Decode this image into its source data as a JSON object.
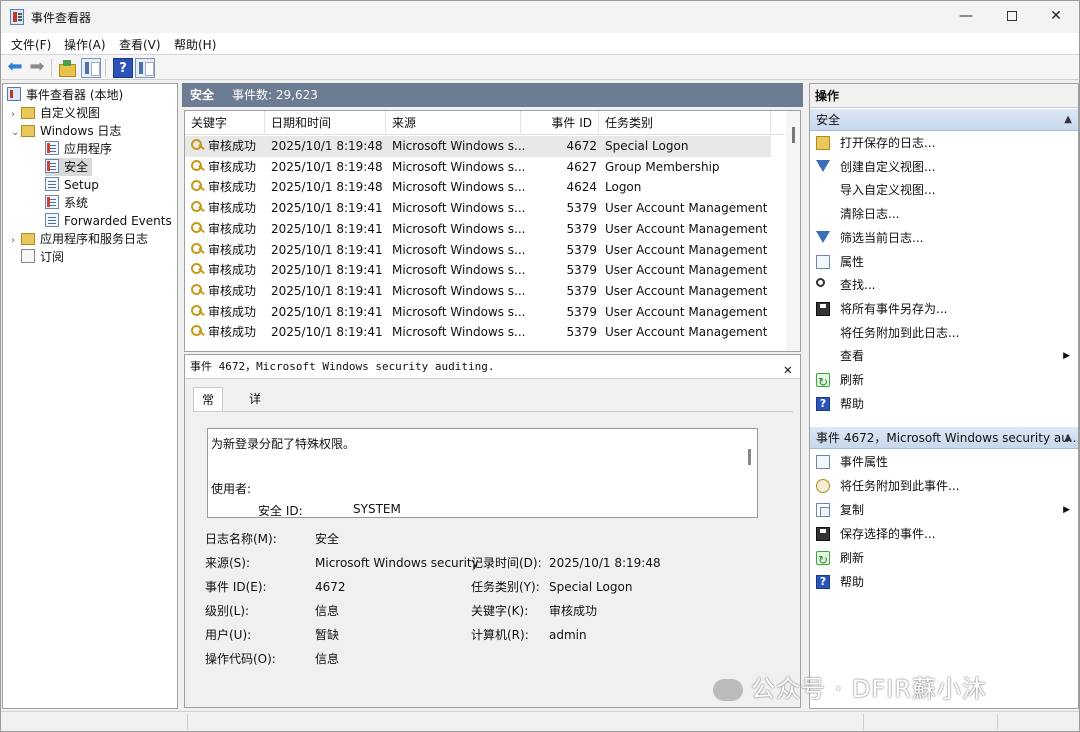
{
  "window": {
    "title": "事件查看器",
    "min": "—",
    "close": "✕"
  },
  "menu": [
    "文件(F)",
    "操作(A)",
    "查看(V)",
    "帮助(H)"
  ],
  "toolbar": {
    "help": "?"
  },
  "tree": {
    "items": [
      {
        "label": "事件查看器 (本地)"
      },
      {
        "label": "自定义视图"
      },
      {
        "label": "Windows 日志"
      },
      {
        "label": "应用程序"
      },
      {
        "label": "安全"
      },
      {
        "label": "Setup"
      },
      {
        "label": "系统"
      },
      {
        "label": "Forwarded Events"
      },
      {
        "label": "应用程序和服务日志"
      },
      {
        "label": "订阅"
      }
    ]
  },
  "center": {
    "title": "安全",
    "count_label": "事件数: 29,623",
    "columns": [
      "关键字",
      "日期和时间",
      "来源",
      "事件 ID",
      "任务类别"
    ],
    "rows": [
      {
        "keyword": "审核成功",
        "datetime": "2025/10/1 8:19:48",
        "source": "Microsoft Windows s...",
        "event_id": "4672",
        "category": "Special Logon"
      },
      {
        "keyword": "审核成功",
        "datetime": "2025/10/1 8:19:48",
        "source": "Microsoft Windows s...",
        "event_id": "4627",
        "category": "Group Membership"
      },
      {
        "keyword": "审核成功",
        "datetime": "2025/10/1 8:19:48",
        "source": "Microsoft Windows s...",
        "event_id": "4624",
        "category": "Logon"
      },
      {
        "keyword": "审核成功",
        "datetime": "2025/10/1 8:19:41",
        "source": "Microsoft Windows s...",
        "event_id": "5379",
        "category": "User Account Management"
      },
      {
        "keyword": "审核成功",
        "datetime": "2025/10/1 8:19:41",
        "source": "Microsoft Windows s...",
        "event_id": "5379",
        "category": "User Account Management"
      },
      {
        "keyword": "审核成功",
        "datetime": "2025/10/1 8:19:41",
        "source": "Microsoft Windows s...",
        "event_id": "5379",
        "category": "User Account Management"
      },
      {
        "keyword": "审核成功",
        "datetime": "2025/10/1 8:19:41",
        "source": "Microsoft Windows s...",
        "event_id": "5379",
        "category": "User Account Management"
      },
      {
        "keyword": "审核成功",
        "datetime": "2025/10/1 8:19:41",
        "source": "Microsoft Windows s...",
        "event_id": "5379",
        "category": "User Account Management"
      },
      {
        "keyword": "审核成功",
        "datetime": "2025/10/1 8:19:41",
        "source": "Microsoft Windows s...",
        "event_id": "5379",
        "category": "User Account Management"
      },
      {
        "keyword": "审核成功",
        "datetime": "2025/10/1 8:19:41",
        "source": "Microsoft Windows s...",
        "event_id": "5379",
        "category": "User Account Management"
      }
    ]
  },
  "detail": {
    "title": "事件 4672，Microsoft Windows security auditing.",
    "close": "✕",
    "tabs": [
      "常规",
      "详细信息"
    ],
    "description": "为新登录分配了特殊权限。",
    "user_heading": "使用者:",
    "security_id_label": "安全 ID:",
    "security_id_value": "SYSTEM",
    "props": {
      "log_name_label": "日志名称(M):",
      "log_name": "安全",
      "source_label": "来源(S):",
      "source": "Microsoft Windows security",
      "logged_label": "记录时间(D):",
      "logged": "2025/10/1 8:19:48",
      "event_id_label": "事件 ID(E):",
      "event_id": "4672",
      "task_label": "任务类别(Y):",
      "task": "Special Logon",
      "level_label": "级别(L):",
      "level": "信息",
      "keywords_label": "关键字(K):",
      "keywords": "审核成功",
      "user_label": "用户(U):",
      "user": "暂缺",
      "computer_label": "计算机(R):",
      "computer": "admin",
      "opcode_label": "操作代码(O):",
      "opcode": "信息"
    }
  },
  "actions": {
    "title": "操作",
    "section1": "安全",
    "items1": [
      "打开保存的日志...",
      "创建自定义视图...",
      "导入自定义视图...",
      "清除日志...",
      "筛选当前日志...",
      "属性",
      "查找...",
      "将所有事件另存为...",
      "将任务附加到此日志...",
      "查看",
      "刷新",
      "帮助"
    ],
    "section2": "事件 4672，Microsoft Windows security au...",
    "items2": [
      "事件属性",
      "将任务附加到此事件...",
      "复制",
      "保存选择的事件...",
      "刷新",
      "帮助"
    ]
  },
  "watermark": "公众号 · DFIR蘇小沐"
}
